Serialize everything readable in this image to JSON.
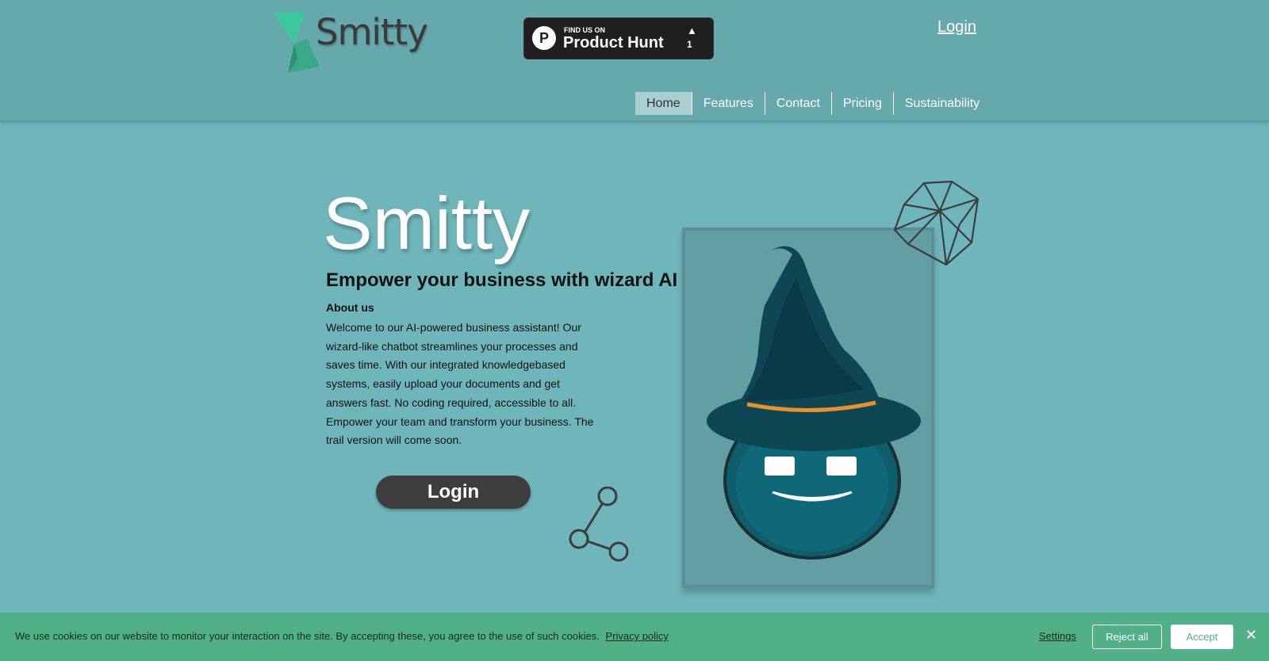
{
  "header": {
    "brand": "Smitty",
    "product_hunt": {
      "small": "FIND US ON",
      "big": "Product Hunt",
      "logo_letter": "P",
      "arrow": "▲",
      "count": "1"
    },
    "login": "Login",
    "nav": [
      "Home",
      "Features",
      "Contact",
      "Pricing",
      "Sustainability"
    ],
    "nav_active": "Home"
  },
  "hero": {
    "title": "Smitty",
    "tagline": "Empower your business with wizard AI",
    "about_heading": "About us",
    "about_text": "Welcome to our AI-powered business assistant! Our wizard-like chatbot streamlines your processes and saves time. With our integrated knowledgebased systems, easily upload your documents and get answers fast. No coding required, accessible to all. Empower your team and transform your business. The trail version will come soon.",
    "cta": "Login"
  },
  "cookie": {
    "text": "We use cookies on our website to monitor your interaction on the site. By accepting these, you agree to the use of such cookies.",
    "privacy_link": "Privacy policy",
    "settings": "Settings",
    "reject": "Reject all",
    "accept": "Accept",
    "close": "✕"
  },
  "colors": {
    "background": "#6fb6bb",
    "header": "#66a9ac",
    "cookie_bar": "#52b087",
    "button_dark": "#3d3d3d",
    "hat": "#0e4654"
  },
  "icons": [
    "smitty-logo-icon",
    "product-hunt-icon",
    "share-icon",
    "wizard-icon",
    "gem-icon",
    "close-icon"
  ]
}
